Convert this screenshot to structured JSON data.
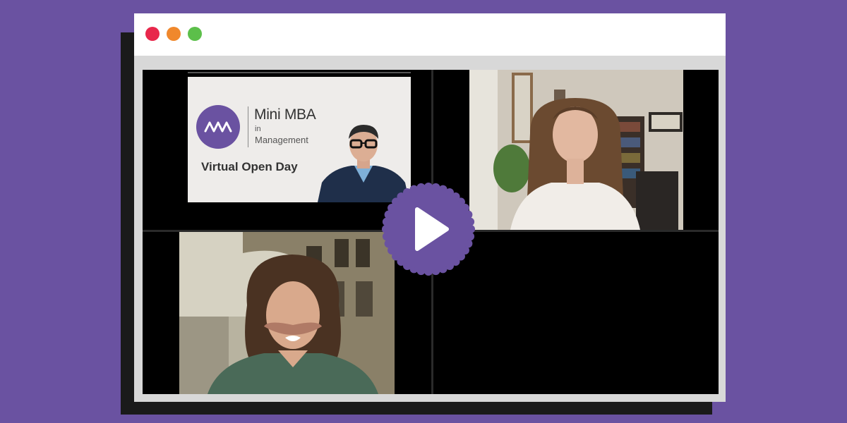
{
  "window": {
    "controls": [
      {
        "name": "close",
        "color": "#e8274b"
      },
      {
        "name": "minimize",
        "color": "#f0882c"
      },
      {
        "name": "maximize",
        "color": "#5cbf4a"
      }
    ]
  },
  "slide": {
    "brand_name": "Mini MBA",
    "brand_sub_1": "in",
    "brand_sub_2": "Management",
    "event_title": "Virtual Open Day",
    "logo_icon": "mw-zigzag-icon"
  },
  "video": {
    "participants": [
      {
        "role": "host-presenter"
      },
      {
        "role": "participant-woman-long-hair"
      },
      {
        "role": "participant-woman-curly-hair"
      }
    ],
    "play_icon": "play-icon"
  },
  "colors": {
    "background": "#6a52a1",
    "accent_purple": "#6a52a1",
    "window": "#ffffff"
  }
}
